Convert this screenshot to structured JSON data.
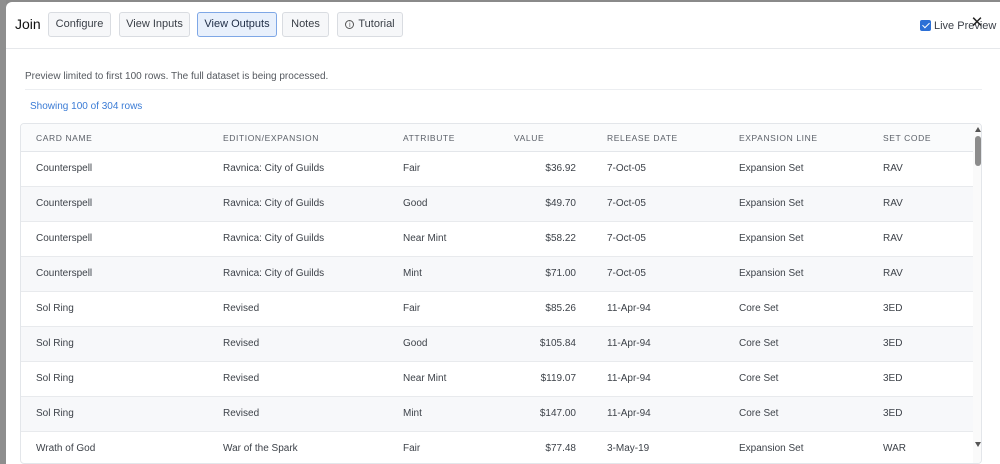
{
  "modal": {
    "title": "Join",
    "tabs": [
      {
        "label": "Configure"
      },
      {
        "label": "View Inputs"
      },
      {
        "label": "View Outputs",
        "active": true
      },
      {
        "label": "Notes"
      },
      {
        "label": "Tutorial",
        "icon": "info-circle-icon"
      }
    ],
    "live_preview": {
      "label": "Live Preview",
      "checked": true
    },
    "close_icon": "close-icon"
  },
  "preview": {
    "note": "Preview limited to first 100 rows. The full dataset is being processed.",
    "row_count": "Showing 100 of 304 rows"
  },
  "table": {
    "columns": [
      "CARD NAME",
      "EDITION/EXPANSION",
      "ATTRIBUTE",
      "VALUE",
      "RELEASE DATE",
      "EXPANSION LINE",
      "SET CODE"
    ],
    "rows": [
      [
        "Counterspell",
        "Ravnica: City of Guilds",
        "Fair",
        "$36.92",
        "7-Oct-05",
        "Expansion Set",
        "RAV"
      ],
      [
        "Counterspell",
        "Ravnica: City of Guilds",
        "Good",
        "$49.70",
        "7-Oct-05",
        "Expansion Set",
        "RAV"
      ],
      [
        "Counterspell",
        "Ravnica: City of Guilds",
        "Near Mint",
        "$58.22",
        "7-Oct-05",
        "Expansion Set",
        "RAV"
      ],
      [
        "Counterspell",
        "Ravnica: City of Guilds",
        "Mint",
        "$71.00",
        "7-Oct-05",
        "Expansion Set",
        "RAV"
      ],
      [
        "Sol Ring",
        "Revised",
        "Fair",
        "$85.26",
        "11-Apr-94",
        "Core Set",
        "3ED"
      ],
      [
        "Sol Ring",
        "Revised",
        "Good",
        "$105.84",
        "11-Apr-94",
        "Core Set",
        "3ED"
      ],
      [
        "Sol Ring",
        "Revised",
        "Near Mint",
        "$119.07",
        "11-Apr-94",
        "Core Set",
        "3ED"
      ],
      [
        "Sol Ring",
        "Revised",
        "Mint",
        "$147.00",
        "11-Apr-94",
        "Core Set",
        "3ED"
      ],
      [
        "Wrath of God",
        "War of the Spark",
        "Fair",
        "$77.48",
        "3-May-19",
        "Expansion Set",
        "WAR"
      ]
    ]
  },
  "colors": {
    "accent": "#2b6fd6",
    "link": "#3a7bd5",
    "active_tab_bg": "#e8f0fc"
  }
}
